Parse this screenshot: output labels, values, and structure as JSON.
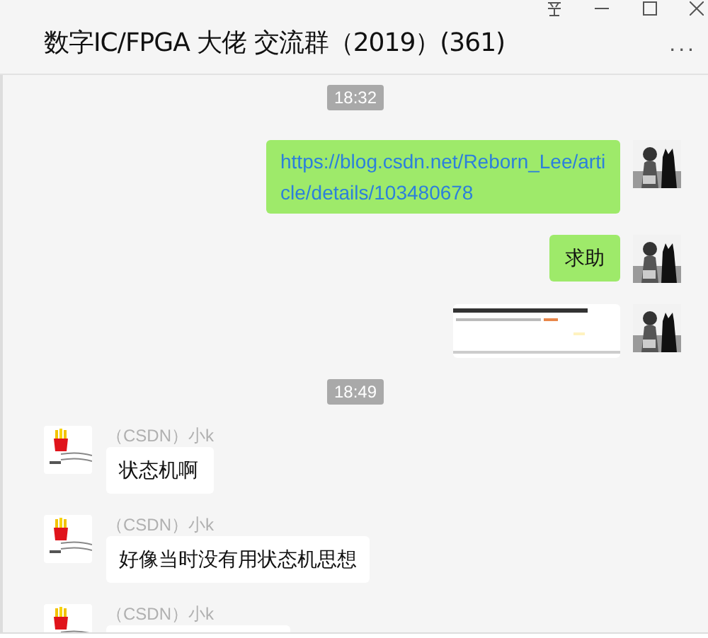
{
  "window": {
    "title": "数字IC/FPGA 大佬 交流群（2019）(361)",
    "more": "..."
  },
  "messages": [
    {
      "kind": "time",
      "text": "18:32"
    },
    {
      "kind": "sent_link",
      "text": "https://blog.csdn.net/Reborn_Lee/article/details/103480678"
    },
    {
      "kind": "sent_text",
      "text": "求助"
    },
    {
      "kind": "sent_picture"
    },
    {
      "kind": "time",
      "text": "18:49"
    },
    {
      "kind": "received_text",
      "sender": "（CSDN）小k",
      "text": "状态机啊"
    },
    {
      "kind": "received_text",
      "sender": "（CSDN）小k",
      "text": "好像当时没有用状态机思想"
    },
    {
      "kind": "received_cut",
      "sender": "（CSDN）小k"
    }
  ]
}
